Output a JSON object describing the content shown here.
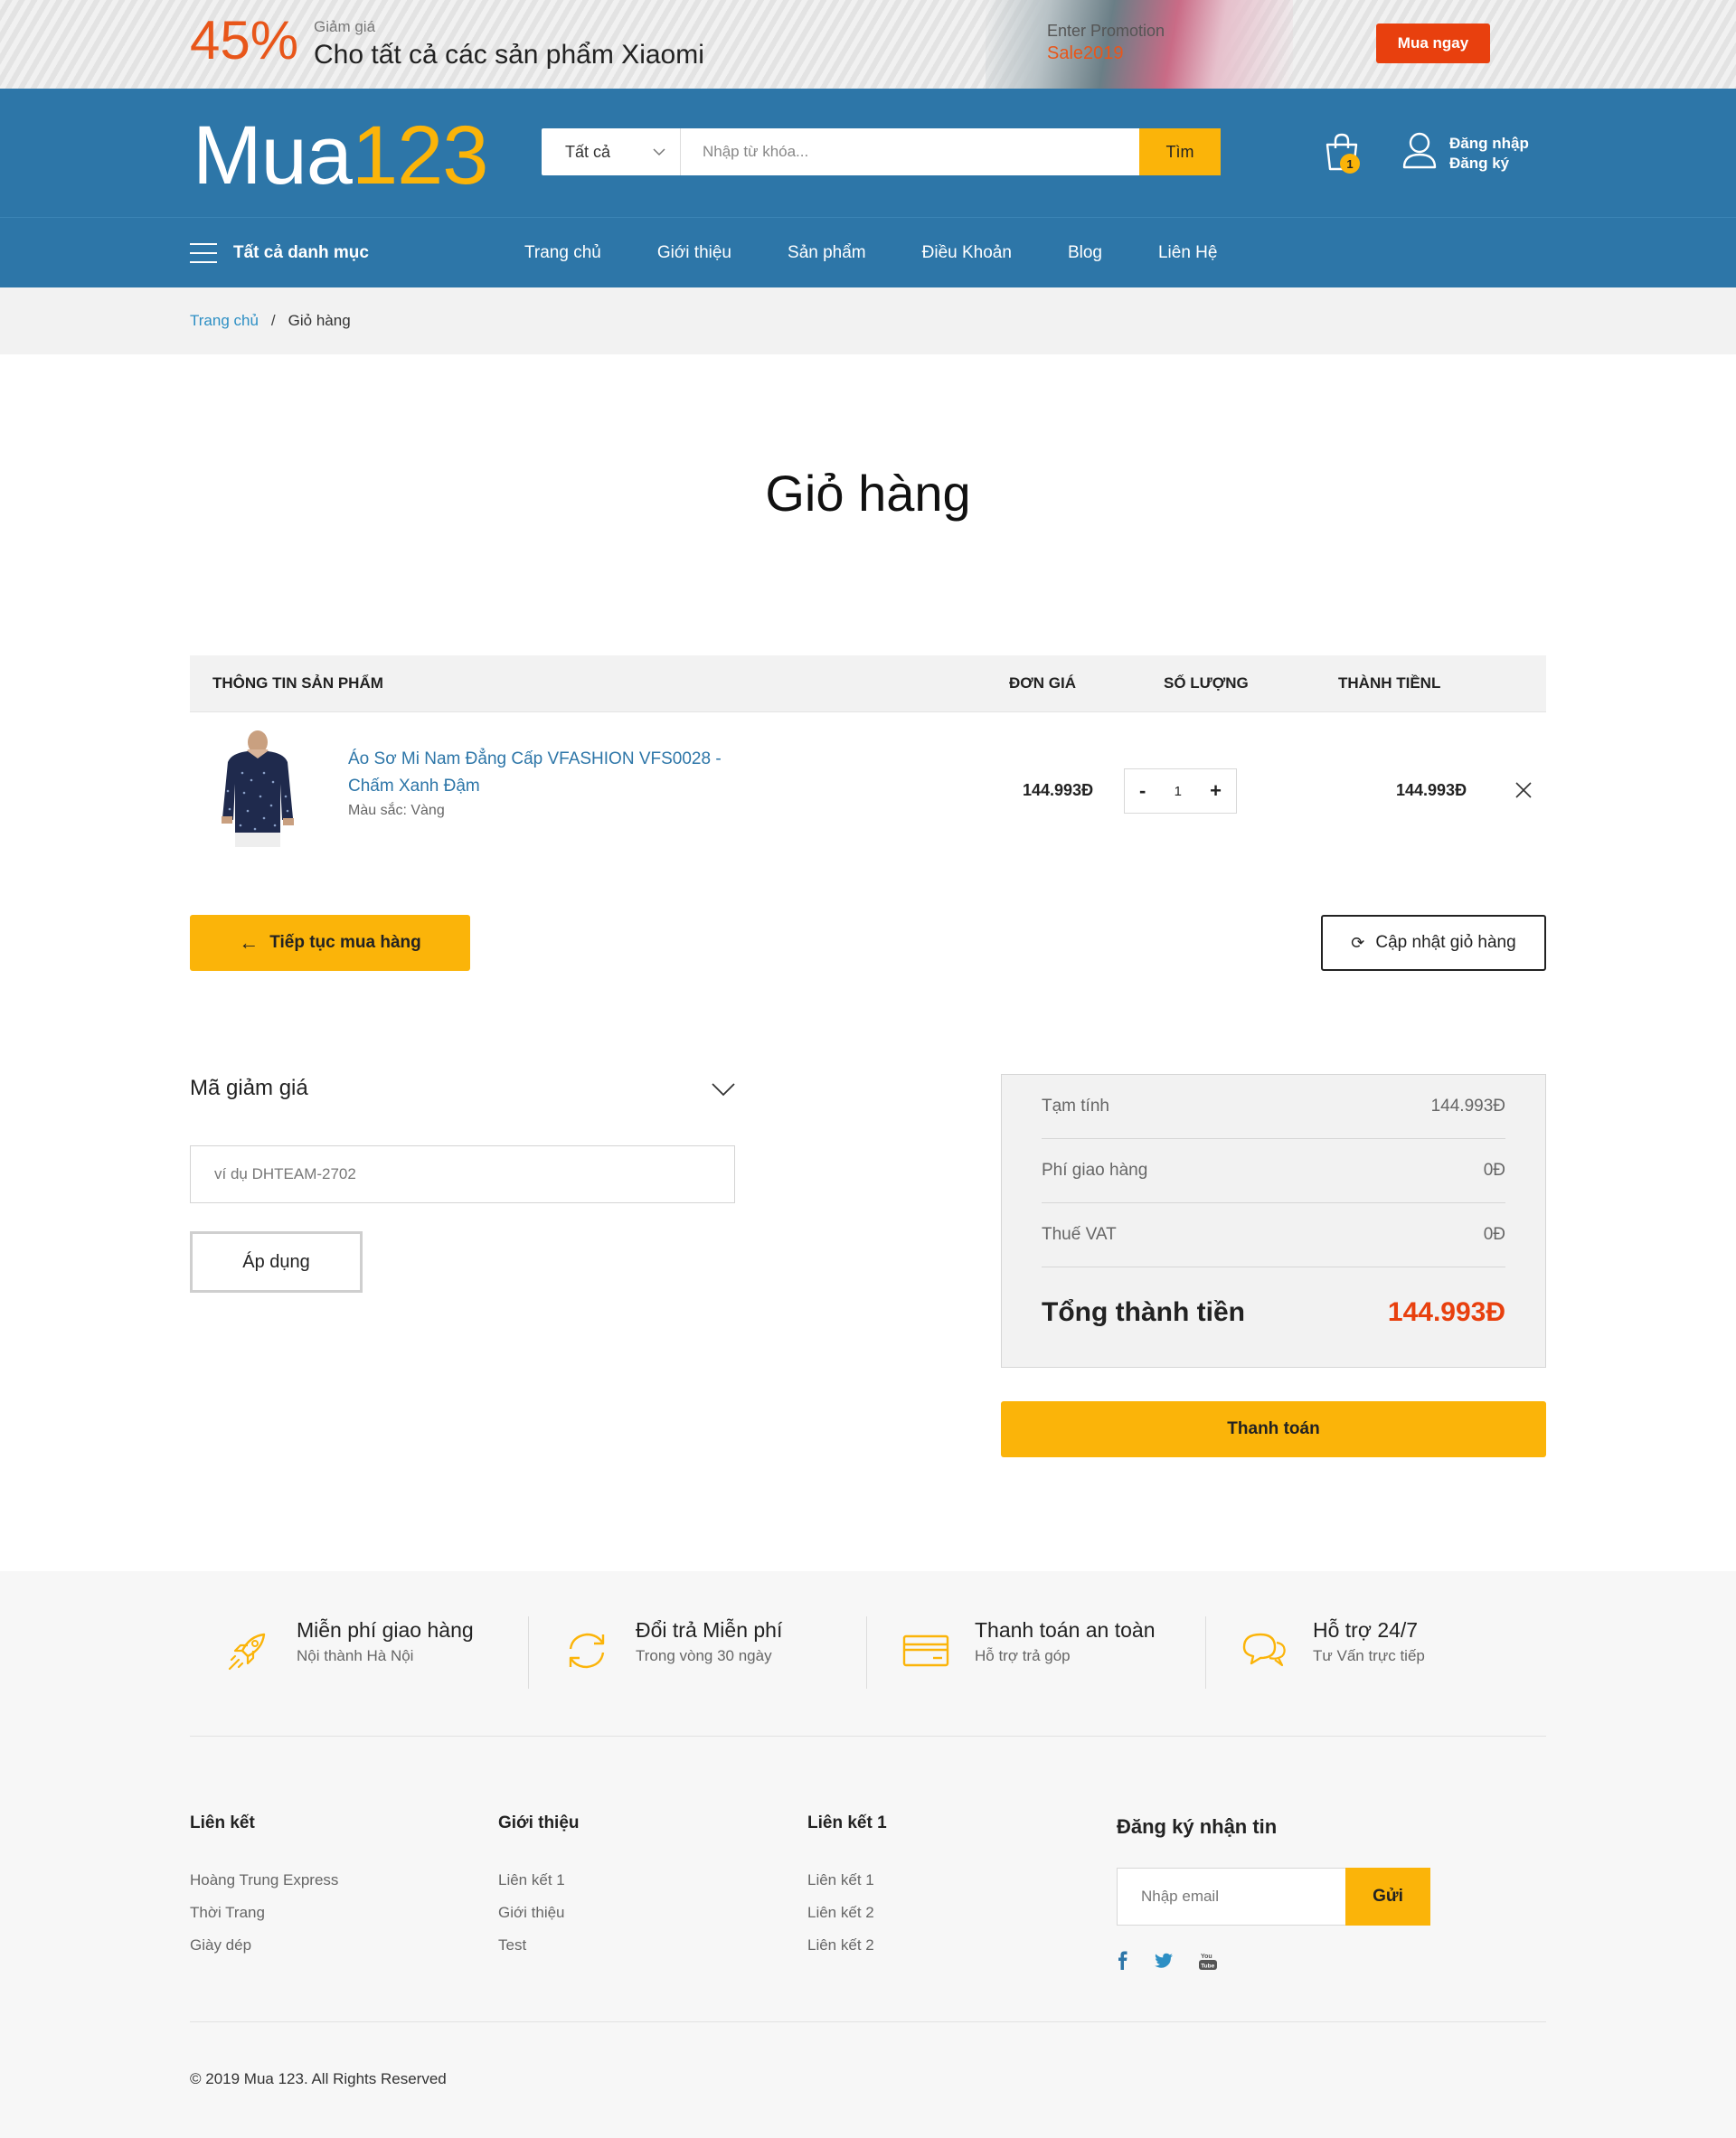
{
  "promo": {
    "percent": "45%",
    "small": "Giảm giá",
    "big": "Cho tất cả các sản phẩm Xiaomi",
    "image_line1": "Enter Promotion",
    "image_line2": "Sale2019",
    "button": "Mua ngay"
  },
  "header": {
    "logo_text": "Mua",
    "logo_num": "123",
    "search_category": "Tất cả",
    "search_placeholder": "Nhập từ khóa...",
    "search_button": "Tìm",
    "cart_count": "1",
    "login": "Đăng nhập",
    "register": "Đăng ký"
  },
  "nav": {
    "all_categories": "Tất cả danh mục",
    "links": [
      "Trang chủ",
      "Giới thiệu",
      "Sản phẩm",
      "Điều Khoản",
      "Blog",
      "Liên Hệ"
    ]
  },
  "breadcrumb": {
    "home": "Trang chủ",
    "separator": "/",
    "current": "Giỏ hàng"
  },
  "page_title": "Giỏ hàng",
  "cart": {
    "headers": {
      "product": "THÔNG TIN SẢN PHẨM",
      "price": "ĐƠN GIÁ",
      "qty": "SỐ LƯỢNG",
      "total": "THÀNH TIỀNL"
    },
    "item": {
      "name": "Áo Sơ Mi Nam Đẳng Cấp VFASHION VFS0028 - Chấm Xanh Đậm",
      "color": "Màu sắc: Vàng",
      "price": "144.993Đ",
      "qty": "1",
      "minus": "-",
      "plus": "+",
      "total": "144.993Đ"
    },
    "continue_button": "Tiếp tục mua hàng",
    "update_button": "Cập nhật giỏ hàng"
  },
  "coupon": {
    "title": "Mã giảm giá",
    "placeholder": "ví dụ DHTEAM-2702",
    "apply_button": "Áp dụng"
  },
  "summary": {
    "subtotal_label": "Tạm tính",
    "subtotal_value": "144.993Đ",
    "shipping_label": "Phí giao hàng",
    "shipping_value": "0Đ",
    "vat_label": "Thuế VAT",
    "vat_value": "0Đ",
    "total_label": "Tổng thành tiền",
    "total_value": "144.993Đ",
    "checkout_button": "Thanh toán"
  },
  "features": [
    {
      "title": "Miễn phí giao hàng",
      "sub": "Nội thành Hà Nội",
      "icon": "rocket-icon"
    },
    {
      "title": "Đổi trả Miễn phí",
      "sub": "Trong vòng 30 ngày",
      "icon": "refresh-icon"
    },
    {
      "title": "Thanh toán an toàn",
      "sub": "Hỗ trợ trả góp",
      "icon": "card-icon"
    },
    {
      "title": "Hỗ trợ 24/7",
      "sub": "Tư Vấn trực tiếp",
      "icon": "chat-icon"
    }
  ],
  "footer": {
    "col1": {
      "title": "Liên kết",
      "links": [
        "Hoàng Trung Express",
        "Thời Trang",
        "Giày dép"
      ]
    },
    "col2": {
      "title": "Giới thiệu",
      "links": [
        "Liên kết 1",
        "Giới thiệu",
        "Test"
      ]
    },
    "col3": {
      "title": "Liên kết 1",
      "links": [
        "Liên kết 1",
        "Liên kết 2",
        "Liên kết 2"
      ]
    },
    "newsletter_title": "Đăng ký nhận tin",
    "newsletter_placeholder": "Nhập email",
    "newsletter_button": "Gửi",
    "copyright": "© 2019 Mua 123. All Rights Reserved"
  },
  "colors": {
    "primary_blue": "#2d76a8",
    "accent_yellow": "#fbb409",
    "accent_orange": "#e8400e"
  }
}
